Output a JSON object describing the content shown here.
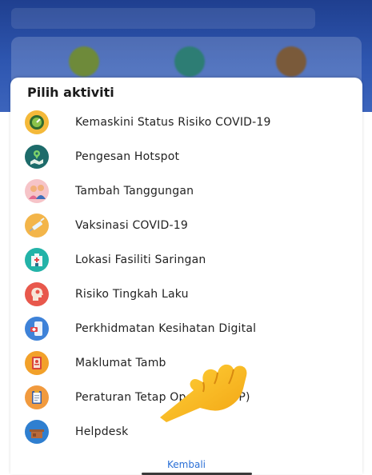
{
  "sheet": {
    "title": "Pilih aktiviti",
    "items": [
      {
        "label": "Kemaskini Status Risiko COVID-19",
        "icon": "gauge-icon",
        "color": "#f4b93a"
      },
      {
        "label": "Pengesan Hotspot",
        "icon": "map-pin-icon",
        "color": "#1d6b6a"
      },
      {
        "label": "Tambah Tanggungan",
        "icon": "family-icon",
        "color": "#f6c4c8"
      },
      {
        "label": "Vaksinasi COVID-19",
        "icon": "syringe-icon",
        "color": "#f3b54a"
      },
      {
        "label": "Lokasi Fasiliti Saringan",
        "icon": "hospital-icon",
        "color": "#23b3a8"
      },
      {
        "label": "Risiko Tingkah Laku",
        "icon": "head-icon",
        "color": "#e8584c"
      },
      {
        "label": "Perkhidmatan Kesihatan Digital",
        "icon": "phone-health-icon",
        "color": "#3e82d8"
      },
      {
        "label": "Maklumat Tamb",
        "icon": "info-card-icon",
        "color": "#f2a12a"
      },
      {
        "label": "Peraturan Tetap Operasi (SOP)",
        "icon": "clipboard-icon",
        "color": "#f19a3e"
      },
      {
        "label": "Helpdesk",
        "icon": "desk-icon",
        "color": "#2f7fd0"
      }
    ],
    "back_label": "Kembali"
  }
}
